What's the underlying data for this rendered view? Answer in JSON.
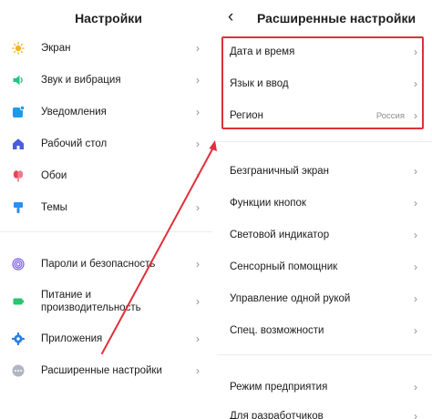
{
  "left": {
    "title": "Настройки",
    "items_top": [
      {
        "label": "Экран",
        "icon": "sun-icon"
      },
      {
        "label": "Звук и вибрация",
        "icon": "speaker-icon"
      },
      {
        "label": "Уведомления",
        "icon": "notification-icon"
      },
      {
        "label": "Рабочий стол",
        "icon": "home-icon"
      },
      {
        "label": "Обои",
        "icon": "flower-icon"
      },
      {
        "label": "Темы",
        "icon": "brush-icon"
      }
    ],
    "items_bottom": [
      {
        "label": "Пароли и безопасность",
        "icon": "fingerprint-icon"
      },
      {
        "label_line1": "Питание и",
        "label_line2": "производительность",
        "icon": "battery-icon"
      },
      {
        "label": "Приложения",
        "icon": "gear-icon"
      },
      {
        "label": "Расширенные настройки",
        "icon": "more-dots-icon"
      }
    ]
  },
  "right": {
    "title": "Расширенные настройки",
    "highlighted": [
      {
        "label": "Дата и время"
      },
      {
        "label": "Язык и ввод"
      },
      {
        "label": "Регион",
        "value": "Россия"
      }
    ],
    "items": [
      {
        "label": "Безграничный экран"
      },
      {
        "label": "Функции кнопок"
      },
      {
        "label": "Световой индикатор"
      },
      {
        "label": "Сенсорный помощник"
      },
      {
        "label": "Управление одной рукой"
      },
      {
        "label": "Спец. возможности"
      }
    ],
    "items_bottom": [
      {
        "label": "Режим предприятия"
      },
      {
        "label": "Для разработчиков"
      }
    ]
  },
  "chevron": "›",
  "back": "‹",
  "colors": {
    "highlight": "#e0303b",
    "sun": "#f2b51d",
    "speaker": "#26c281",
    "notification": "#1e9be8",
    "home": "#4a5de0",
    "flower": "#e9425b",
    "brush": "#2a8ff0",
    "fingerprint": "#7b5cf0",
    "battery": "#2cc46e",
    "gear": "#2b7fe0",
    "dots": "#b0b6c2"
  }
}
